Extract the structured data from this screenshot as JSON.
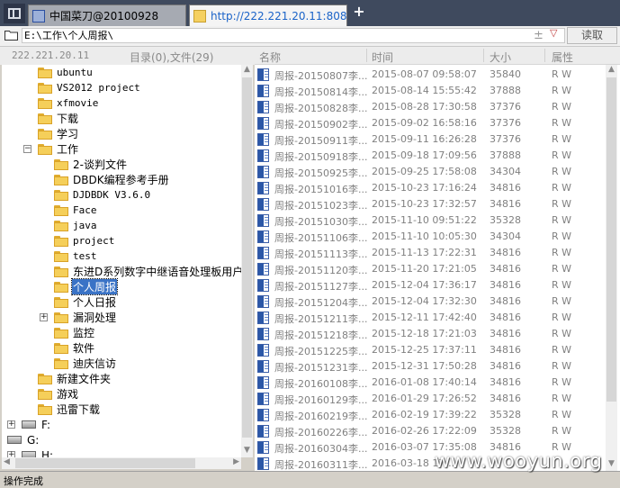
{
  "tabs": [
    {
      "label": "中国菜刀@20100928",
      "active": false
    },
    {
      "label": "http://222.221.20.11:8080/...",
      "active": true
    }
  ],
  "new_tab_symbol": "+",
  "address": {
    "path": "E:\\工作\\个人周报\\",
    "plus_symbol": "±",
    "dropdown_symbol": "▽",
    "read_button": "读取"
  },
  "left_header": {
    "ip": "222.221.20.11",
    "counts": "目录(0),文件(29)"
  },
  "tree": [
    {
      "label": "ubuntu",
      "level": 1,
      "mono": true
    },
    {
      "label": "VS2012 project",
      "level": 1,
      "mono": true
    },
    {
      "label": "xfmovie",
      "level": 1,
      "mono": true
    },
    {
      "label": "下载",
      "level": 1
    },
    {
      "label": "学习",
      "level": 1
    },
    {
      "label": "工作",
      "level": 1,
      "expander": "−"
    },
    {
      "label": "2-谈判文件",
      "level": 2
    },
    {
      "label": "DBDK编程参考手册",
      "level": 2
    },
    {
      "label": "DJDBDK V3.6.0",
      "level": 2,
      "mono": true
    },
    {
      "label": "Face",
      "level": 2,
      "mono": true
    },
    {
      "label": "java",
      "level": 2,
      "mono": true
    },
    {
      "label": "project",
      "level": 2,
      "mono": true
    },
    {
      "label": "test",
      "level": 2,
      "mono": true
    },
    {
      "label": "东进D系列数字中继语音处理板用户",
      "level": 2
    },
    {
      "label": "个人周报",
      "level": 2,
      "selected": true
    },
    {
      "label": "个人日报",
      "level": 2
    },
    {
      "label": "漏洞处理",
      "level": 2,
      "expander": "+"
    },
    {
      "label": "监控",
      "level": 2
    },
    {
      "label": "软件",
      "level": 2
    },
    {
      "label": "迪庆信访",
      "level": 2
    },
    {
      "label": "新建文件夹",
      "level": 1
    },
    {
      "label": "游戏",
      "level": 1
    },
    {
      "label": "迅雷下载",
      "level": 1
    },
    {
      "label": "F:",
      "level": 0,
      "drive": true,
      "expander": "+"
    },
    {
      "label": "G:",
      "level": 0,
      "drive": true
    },
    {
      "label": "H:",
      "level": 0,
      "drive": true,
      "expander": "+"
    }
  ],
  "file_columns": [
    "名称",
    "时间",
    "大小",
    "属性"
  ],
  "files": [
    {
      "name": "周报-20150807李...",
      "time": "2015-08-07 09:58:07",
      "size": "35840",
      "attr": "R W"
    },
    {
      "name": "周报-20150814李...",
      "time": "2015-08-14 15:55:42",
      "size": "37888",
      "attr": "R W"
    },
    {
      "name": "周报-20150828李...",
      "time": "2015-08-28 17:30:58",
      "size": "37376",
      "attr": "R W"
    },
    {
      "name": "周报-20150902李...",
      "time": "2015-09-02 16:58:16",
      "size": "37376",
      "attr": "R W"
    },
    {
      "name": "周报-20150911李...",
      "time": "2015-09-11 16:26:28",
      "size": "37376",
      "attr": "R W"
    },
    {
      "name": "周报-20150918李...",
      "time": "2015-09-18 17:09:56",
      "size": "37888",
      "attr": "R W"
    },
    {
      "name": "周报-20150925李...",
      "time": "2015-09-25 17:58:08",
      "size": "34304",
      "attr": "R W"
    },
    {
      "name": "周报-20151016李...",
      "time": "2015-10-23 17:16:24",
      "size": "34816",
      "attr": "R W"
    },
    {
      "name": "周报-20151023李...",
      "time": "2015-10-23 17:32:57",
      "size": "34816",
      "attr": "R W"
    },
    {
      "name": "周报-20151030李...",
      "time": "2015-11-10 09:51:22",
      "size": "35328",
      "attr": "R W"
    },
    {
      "name": "周报-20151106李...",
      "time": "2015-11-10 10:05:30",
      "size": "34304",
      "attr": "R W"
    },
    {
      "name": "周报-20151113李...",
      "time": "2015-11-13 17:22:31",
      "size": "34816",
      "attr": "R W"
    },
    {
      "name": "周报-20151120李...",
      "time": "2015-11-20 17:21:05",
      "size": "34816",
      "attr": "R W"
    },
    {
      "name": "周报-20151127李...",
      "time": "2015-12-04 17:36:17",
      "size": "34816",
      "attr": "R W"
    },
    {
      "name": "周报-20151204李...",
      "time": "2015-12-04 17:32:30",
      "size": "34816",
      "attr": "R W"
    },
    {
      "name": "周报-20151211李...",
      "time": "2015-12-11 17:42:40",
      "size": "34816",
      "attr": "R W"
    },
    {
      "name": "周报-20151218李...",
      "time": "2015-12-18 17:21:03",
      "size": "34816",
      "attr": "R W"
    },
    {
      "name": "周报-20151225李...",
      "time": "2015-12-25 17:37:11",
      "size": "34816",
      "attr": "R W"
    },
    {
      "name": "周报-20151231李...",
      "time": "2015-12-31 17:50:28",
      "size": "34816",
      "attr": "R W"
    },
    {
      "name": "周报-20160108李...",
      "time": "2016-01-08 17:40:14",
      "size": "34816",
      "attr": "R W"
    },
    {
      "name": "周报-20160129李...",
      "time": "2016-01-29 17:26:52",
      "size": "34816",
      "attr": "R W"
    },
    {
      "name": "周报-20160219李...",
      "time": "2016-02-19 17:39:22",
      "size": "35328",
      "attr": "R W"
    },
    {
      "name": "周报-20160226李...",
      "time": "2016-02-26 17:22:09",
      "size": "35328",
      "attr": "R W"
    },
    {
      "name": "周报-20160304李...",
      "time": "2016-03-07 17:35:08",
      "size": "34816",
      "attr": "R W"
    },
    {
      "name": "周报-20160311李...",
      "time": "2016-03-18 17:...",
      "size": "",
      "attr": ""
    }
  ],
  "status": "操作完成",
  "watermark": "www.wooyun.org"
}
